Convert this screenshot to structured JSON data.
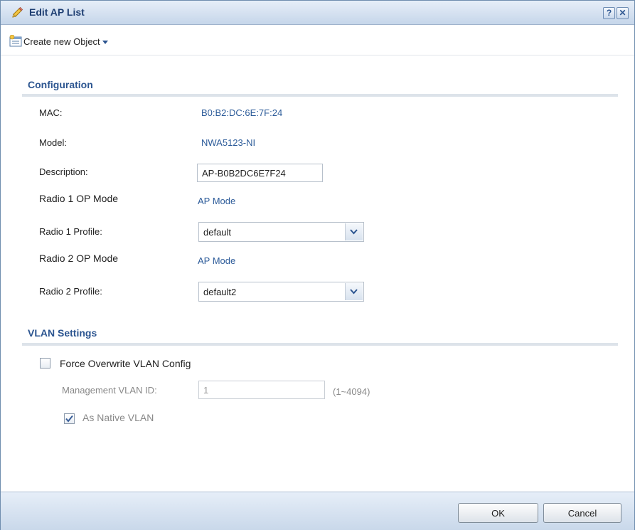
{
  "window": {
    "title": "Edit AP List",
    "help_label": "?",
    "close_label": "✕"
  },
  "toolbar": {
    "create_label": "Create new Object"
  },
  "configuration": {
    "section_title": "Configuration",
    "mac_label": "MAC:",
    "mac_value": "B0:B2:DC:6E:7F:24",
    "model_label": "Model:",
    "model_value": "NWA5123-NI",
    "description_label": "Description:",
    "description_value": "AP-B0B2DC6E7F24",
    "radio1_op_label": "Radio 1 OP Mode",
    "radio1_op_value": "AP Mode",
    "radio1_profile_label": "Radio 1 Profile:",
    "radio1_profile_value": "default",
    "radio2_op_label": "Radio 2 OP Mode",
    "radio2_op_value": "AP Mode",
    "radio2_profile_label": "Radio 2 Profile:",
    "radio2_profile_value": "default2"
  },
  "vlan": {
    "section_title": "VLAN Settings",
    "force_overwrite_label": "Force Overwrite VLAN Config",
    "force_overwrite_checked": false,
    "mgmt_vlan_label": "Management VLAN ID:",
    "mgmt_vlan_value": "1",
    "mgmt_vlan_range": "(1~4094)",
    "native_vlan_label": "As Native VLAN",
    "native_vlan_checked": true
  },
  "footer": {
    "ok_label": "OK",
    "cancel_label": "Cancel"
  },
  "colors": {
    "accent": "#2c5590",
    "link": "#2c5b99",
    "titlebar": "#c6d6ea"
  },
  "icons": {
    "title": "pencil-icon",
    "create": "object-list-icon",
    "dropdown": "chevron-down-icon"
  }
}
